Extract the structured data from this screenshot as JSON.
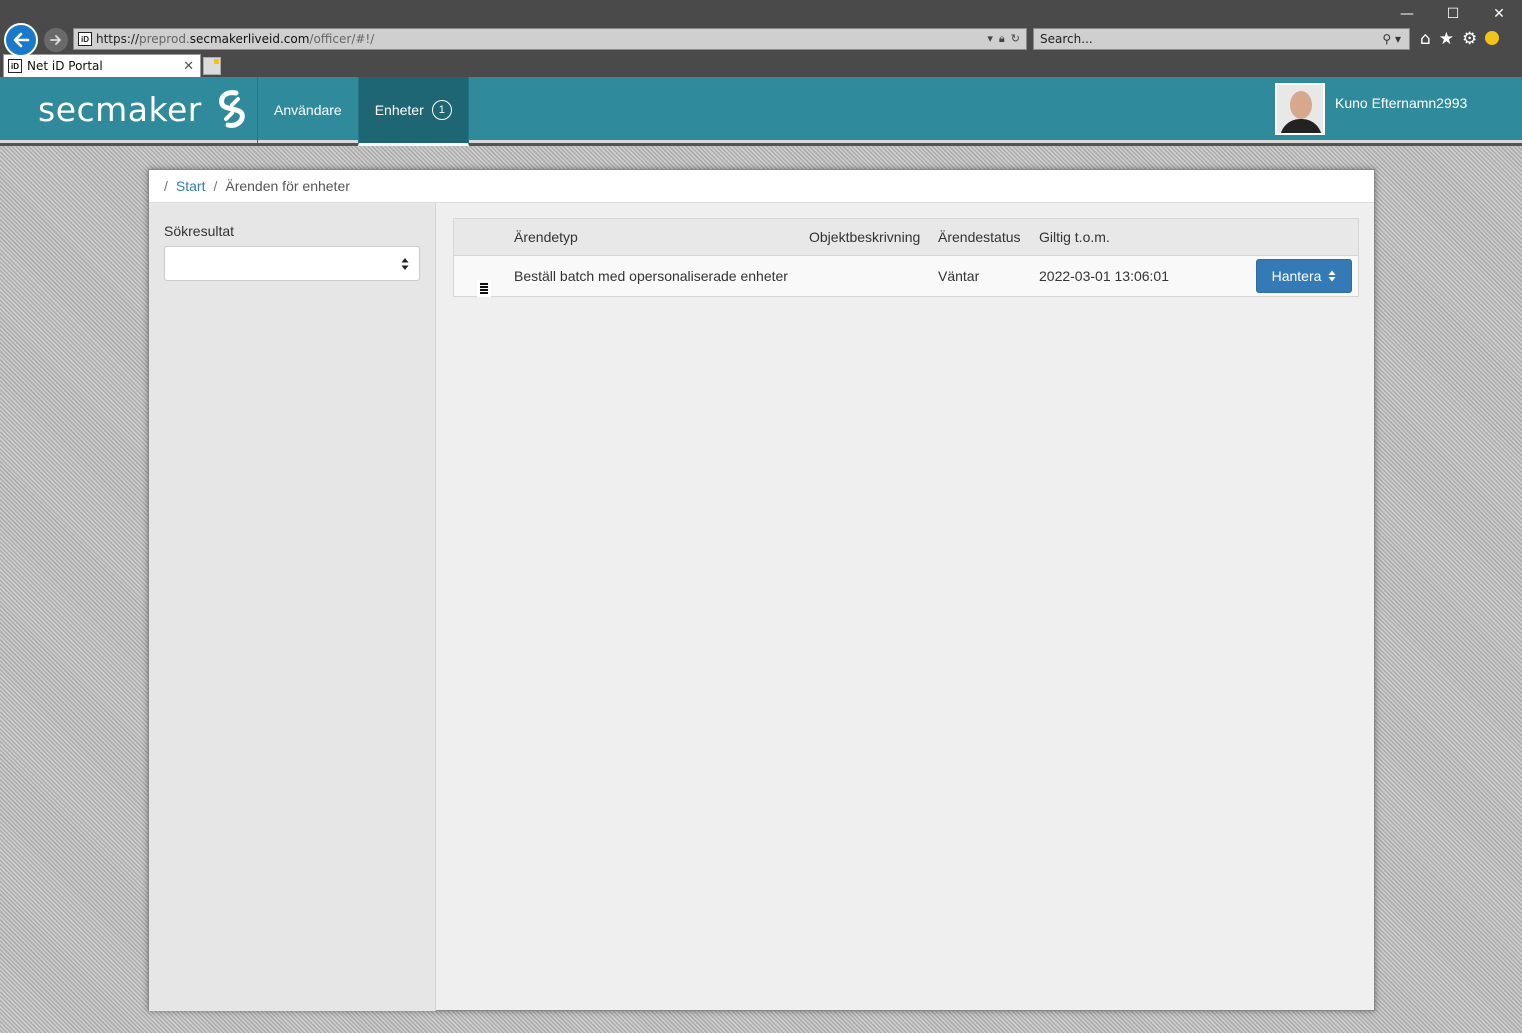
{
  "browser": {
    "url_prefix": "https://",
    "url_domain_sub": "preprod.",
    "url_domain": "secmakerliveid.com",
    "url_path": "/officer/#!/",
    "search_placeholder": "Search...",
    "tab_title": "Net iD Portal",
    "site_icon_text": "iD"
  },
  "header": {
    "brand": "secmaker",
    "nav": [
      {
        "label": "Användare",
        "active": false
      },
      {
        "label": "Enheter",
        "active": true,
        "badge": "1"
      }
    ],
    "user_name": "Kuno Efternamn2993"
  },
  "breadcrumb": {
    "home": "Start",
    "current": "Ärenden för enheter"
  },
  "sidebar": {
    "label": "Sökresultat",
    "select_value": ""
  },
  "table": {
    "headers": [
      "Ärendetyp",
      "Objektbeskrivning",
      "Ärendestatus",
      "Giltig t.o.m."
    ],
    "rows": [
      {
        "type": "Beställ batch med opersonaliserade enheter",
        "description": "",
        "status": "Väntar",
        "valid_until": "2022-03-01 13:06:01",
        "action": "Hantera"
      }
    ]
  },
  "colors": {
    "header_bg": "#2f8a9b",
    "nav_active_bg": "#1f6674",
    "primary_button": "#337ab7",
    "link": "#337ab7"
  }
}
